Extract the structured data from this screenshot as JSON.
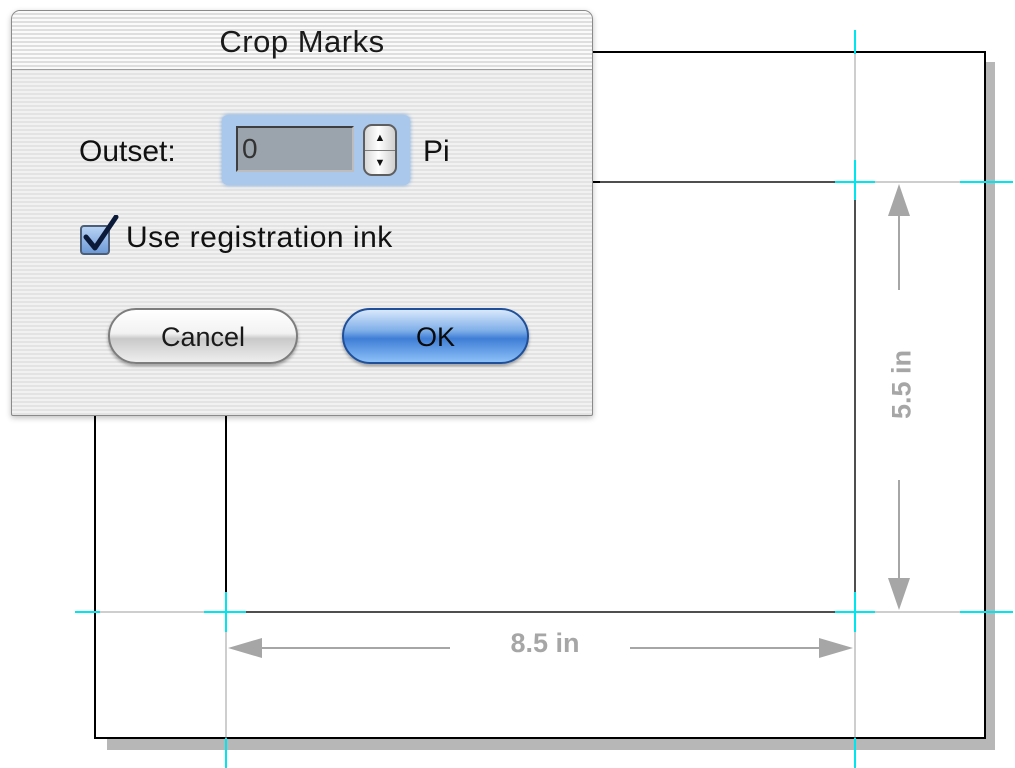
{
  "dialog": {
    "title": "Crop Marks",
    "outset": {
      "label": "Outset:",
      "value": "0",
      "unit": "Pi"
    },
    "registration_ink": {
      "label": "Use registration ink",
      "checked": true
    },
    "buttons": {
      "cancel": "Cancel",
      "ok": "OK"
    }
  },
  "illustration": {
    "width_label": "8.5 in",
    "height_label": "5.5 in"
  },
  "colors": {
    "crop_mark": "#00e5ee",
    "dimension": "#a6a6a6",
    "ok_button": "#3f7ed6"
  }
}
